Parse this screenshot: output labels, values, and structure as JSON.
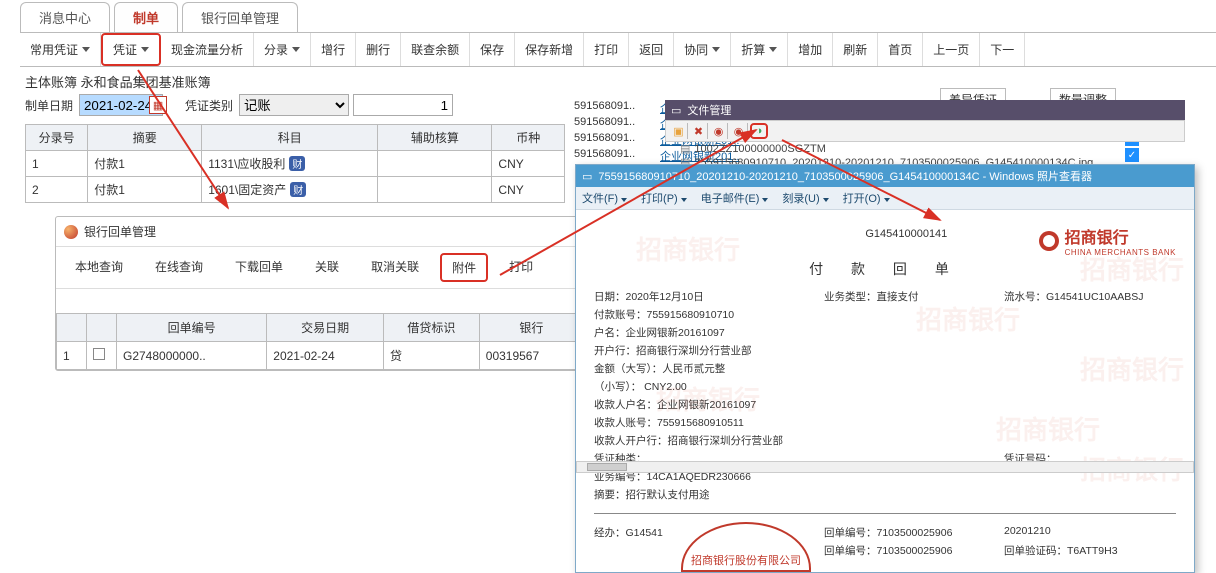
{
  "top_tabs": {
    "msg": "消息中心",
    "make": "制单",
    "bank": "银行回单管理"
  },
  "toolbar": {
    "common_voucher": "常用凭证",
    "voucher": "凭证",
    "cashflow": "现金流量分析",
    "entry": "分录",
    "add": "增行",
    "del": "删行",
    "balance": "联查余额",
    "save": "保存",
    "save_new": "保存新增",
    "print": "打印",
    "back": "返回",
    "coop": "协同",
    "discount": "折算",
    "add2": "增加",
    "refresh": "刷新",
    "home": "首页",
    "prev": "上一页",
    "next": "下一"
  },
  "ledger_line": "主体账簿 永和食品集团基准账簿",
  "form": {
    "date_label": "制单日期",
    "date_value": "2021-02-24",
    "type_label": "凭证类别",
    "type_value": "记账",
    "seq_value": "1"
  },
  "entry_head": {
    "c1": "分录号",
    "c2": "摘要",
    "c3": "科目",
    "c4": "辅助核算",
    "c5": "币种"
  },
  "entries": [
    {
      "no": "1",
      "summary": "付款1",
      "subject": "1131\\应收股利",
      "tag": "财",
      "currency": "CNY"
    },
    {
      "no": "2",
      "summary": "付款1",
      "subject": "1601\\固定资产",
      "tag": "财",
      "currency": "CNY"
    }
  ],
  "bank_panel": {
    "title": "银行回单管理",
    "btns": {
      "local": "本地查询",
      "online": "在线查询",
      "download": "下载回单",
      "link": "关联",
      "unlink": "取消关联",
      "attach": "附件",
      "print": "打印"
    },
    "head": {
      "c1": "回单编号",
      "c2": "交易日期",
      "c3": "借贷标识",
      "c4": "银行"
    },
    "row": {
      "idx": "1",
      "no": "G2748000000..",
      "date": "2021-02-24",
      "dc": "贷",
      "bank": "00319567"
    }
  },
  "right_rows": [
    {
      "a": "591568091..",
      "b": "企业网银新201.."
    },
    {
      "a": "591568091..",
      "b": "企业网银新201.."
    },
    {
      "a": "591568091..",
      "b": "企业网银新201.."
    },
    {
      "a": "591568091..",
      "b": "企业网银新201.."
    }
  ],
  "right_label1": "差异凭证",
  "right_label2": "数量调整",
  "fm_title": "文件管理",
  "fm_file1": "1002ZZ100000000SGZTM",
  "fm_file2": "755915680910710_20201210-20201210_7103500025906_G145410000134C.jpg",
  "viewer": {
    "title": "755915680910710_20201210-20201210_7103500025906_G145410000134C - Windows 照片查看器",
    "menu": {
      "file": "文件(F)",
      "print": "打印(P)",
      "mail": "电子邮件(E)",
      "burn": "刻录(U)",
      "open": "打开(O)"
    },
    "receipt_no": "G145410000141",
    "bank_name": "招商银行",
    "bank_sub": "CHINA MERCHANTS BANK",
    "receipt_title": "付 款 回 单",
    "f": {
      "date": "日期：2020年12月10日",
      "biztype": "业务类型：直接支付",
      "serial": "流水号：G14541UC10AABSJ",
      "acct": "付款账号：755915680910710",
      "name": "户名：企业网银新20161097",
      "open": "开户行：招商银行深圳分行营业部",
      "amt_u": "金额（大写）：人民币贰元整",
      "amt_l": "（小写）：  CNY2.00",
      "payee_name": "收款人户名：企业网银新20161097",
      "payee_acct": "收款人账号：755915680910511",
      "payee_open": "收款人开户行：招商银行深圳分行营业部",
      "vno_lbl": "凭证种类：",
      "vno": "凭证号码：",
      "bizno": "业务编号：14CA1AQEDR230666",
      "memo": "摘要：招行默认支付用途",
      "handler": "经办：G14541",
      "slip": "回单编号：7103500025906",
      "slip_date": "20201210",
      "slip2": "回单编号：7103500025906",
      "slip_verify": "回单验证码：T6ATT9H3"
    },
    "stamp": "招商银行股份有限公司"
  }
}
